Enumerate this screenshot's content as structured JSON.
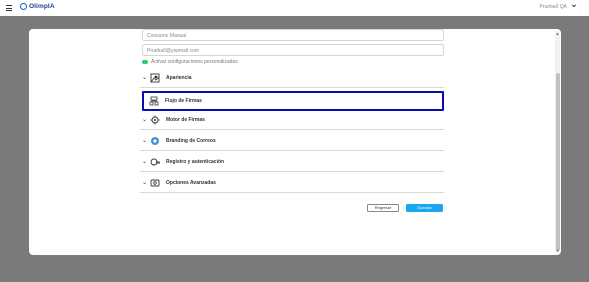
{
  "app": {
    "brand": "OlimpIA",
    "user_label": "Prueba0 QA"
  },
  "form": {
    "name_value": "Consumo Manual",
    "email_value": "Prueba0@yopmail.com",
    "toggle_label": "Activar configuraciones personalizadas"
  },
  "sections": [
    {
      "label": "Apariencia",
      "icon": "appearance-icon",
      "selected": false
    },
    {
      "label": "Flujo de Firmas",
      "icon": "signature-flow-icon",
      "selected": true
    },
    {
      "label": "Motor de Firmas",
      "icon": "signature-engine-icon",
      "selected": false
    },
    {
      "label": "Branding de Correos",
      "icon": "email-branding-icon",
      "selected": false
    },
    {
      "label": "Registro y autenticación",
      "icon": "auth-icon",
      "selected": false
    },
    {
      "label": "Opciones Avanzadas",
      "icon": "advanced-options-icon",
      "selected": false
    }
  ],
  "buttons": {
    "back": "Regresar",
    "save": "Guardar"
  },
  "colors": {
    "accent": "#1aa7f0",
    "selection_border": "#0b0bb0",
    "toggle_on": "#2ecc71"
  }
}
